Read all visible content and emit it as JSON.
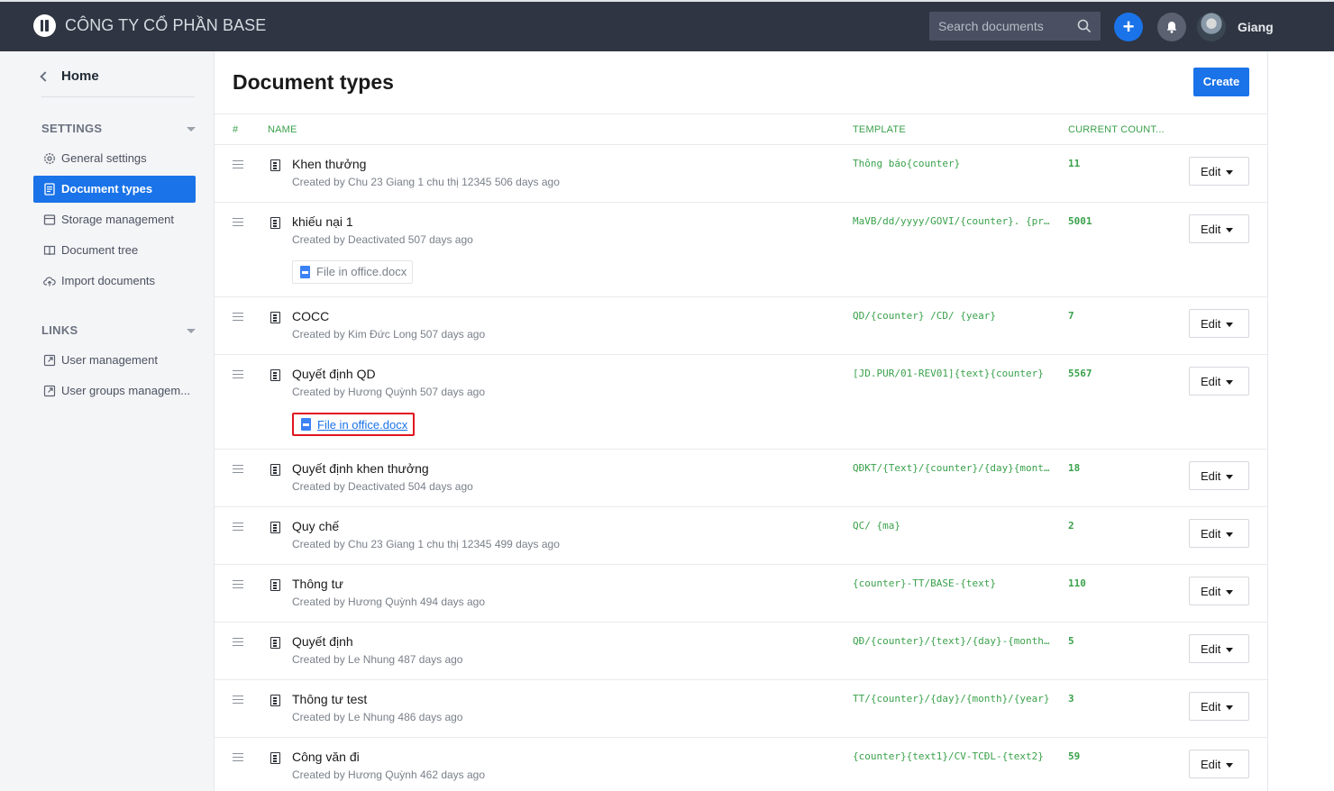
{
  "header": {
    "company": "CÔNG TY CỔ PHẦN BASE",
    "search_placeholder": "Search documents",
    "user_name": "Giang"
  },
  "sidebar": {
    "home": "Home",
    "settings_title": "SETTINGS",
    "settings_items": [
      {
        "label": "General settings",
        "icon": "gear-icon"
      },
      {
        "label": "Document types",
        "icon": "document-icon"
      },
      {
        "label": "Storage management",
        "icon": "storage-icon"
      },
      {
        "label": "Document tree",
        "icon": "book-icon"
      },
      {
        "label": "Import documents",
        "icon": "cloud-upload-icon"
      }
    ],
    "links_title": "LINKS",
    "links_items": [
      {
        "label": "User management",
        "icon": "external-link-icon"
      },
      {
        "label": "User groups managem...",
        "icon": "external-link-icon"
      }
    ]
  },
  "main": {
    "title": "Document types",
    "create_label": "Create",
    "columns": {
      "index": "#",
      "name": "NAME",
      "template": "TEMPLATE",
      "count": "CURRENT COUNT..."
    },
    "edit_label": "Edit",
    "rows": [
      {
        "name": "Khen thưởng",
        "meta": "Created by Chu 23 Giang 1 chu thị 12345 506 days ago",
        "template": "Thông báo{counter}",
        "count": "11"
      },
      {
        "name": "khiếu nại 1",
        "meta": "Created by Deactivated 507 days ago",
        "template": "MaVB/dd/yyyy/GOVI/{counter}. {pr...",
        "count": "5001",
        "file": "File in office.docx"
      },
      {
        "name": "COCC",
        "meta": "Created by Kim Đức Long 507 days ago",
        "template": "QD/{counter} /CD/ {year}",
        "count": "7"
      },
      {
        "name": "Quyết định QD",
        "meta": "Created by Hương Quỳnh 507 days ago",
        "template": "[JD.PUR/01-REV01]{text}{counter}",
        "count": "5567",
        "file": "File in office.docx"
      },
      {
        "name": "Quyết định khen thưởng",
        "meta": "Created by Deactivated 504 days ago",
        "template": "QĐKT/{Text}/{counter}/{day}{mont...",
        "count": "18"
      },
      {
        "name": "Quy chế",
        "meta": "Created by Chu 23 Giang 1 chu thị 12345 499 days ago",
        "template": "QC/ {ma}",
        "count": "2"
      },
      {
        "name": "Thông tư",
        "meta": "Created by Hương Quỳnh 494 days ago",
        "template": "{counter}-TT/BASE-{text}",
        "count": "110"
      },
      {
        "name": "Quyết định",
        "meta": "Created by Le Nhung 487 days ago",
        "template": "QĐ/{counter}/{text}/{day}-{month...",
        "count": "5"
      },
      {
        "name": "Thông tư test",
        "meta": "Created by Le Nhung 486 days ago",
        "template": "TT/{counter}/{day}/{month}/{year}",
        "count": "3"
      },
      {
        "name": "Công văn đi",
        "meta": "Created by Hương Quỳnh 462 days ago",
        "template": "{counter}{text1}/CV-TCĐL-{text2}",
        "count": "59"
      }
    ]
  },
  "colors": {
    "accent": "#1a73e8",
    "topbar": "#2f3542",
    "green": "#3aa14b",
    "highlight": "#e0141e"
  }
}
